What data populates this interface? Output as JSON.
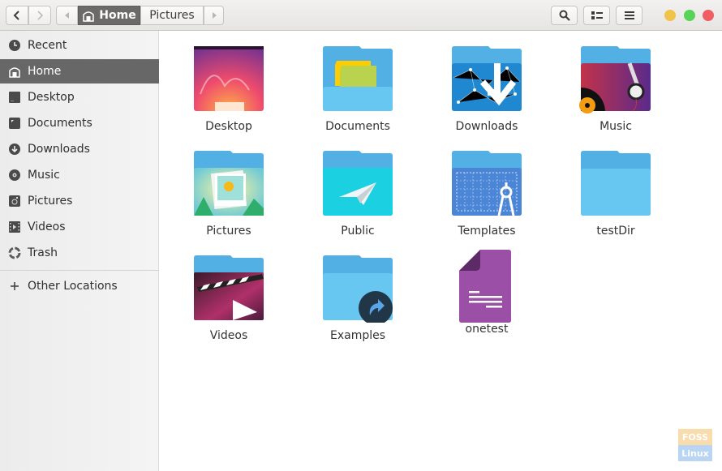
{
  "header": {
    "back_label": "‹",
    "forward_label": "›",
    "path": [
      {
        "label": "Home",
        "icon": "home-icon",
        "active": true
      },
      {
        "label": "Pictures",
        "active": false
      }
    ],
    "search_icon": "search-icon",
    "view_icon": "list-view-icon",
    "menu_icon": "hamburger-menu-icon",
    "window_controls": {
      "minimize_color": "#f0c34b",
      "maximize_color": "#58d357",
      "close_color": "#ee5e63"
    }
  },
  "sidebar": {
    "items": [
      {
        "label": "Recent",
        "icon": "clock-icon"
      },
      {
        "label": "Home",
        "icon": "home-icon",
        "active": true
      },
      {
        "label": "Desktop",
        "icon": "desktop-icon"
      },
      {
        "label": "Documents",
        "icon": "document-icon"
      },
      {
        "label": "Downloads",
        "icon": "download-icon"
      },
      {
        "label": "Music",
        "icon": "music-icon"
      },
      {
        "label": "Pictures",
        "icon": "camera-icon"
      },
      {
        "label": "Videos",
        "icon": "film-icon"
      },
      {
        "label": "Trash",
        "icon": "trash-icon"
      }
    ],
    "other_locations": {
      "label": "Other Locations",
      "icon": "plus-icon"
    }
  },
  "files": [
    {
      "name": "Desktop",
      "type": "desktop-folder"
    },
    {
      "name": "Documents",
      "type": "documents-folder"
    },
    {
      "name": "Downloads",
      "type": "downloads-folder"
    },
    {
      "name": "Music",
      "type": "music-folder"
    },
    {
      "name": "Pictures",
      "type": "pictures-folder"
    },
    {
      "name": "Public",
      "type": "public-folder"
    },
    {
      "name": "Templates",
      "type": "templates-folder"
    },
    {
      "name": "testDir",
      "type": "folder"
    },
    {
      "name": "Videos",
      "type": "videos-folder"
    },
    {
      "name": "Examples",
      "type": "link-folder"
    },
    {
      "name": "onetest",
      "type": "document-file"
    }
  ],
  "watermark": {
    "top": "FOSS",
    "bottom": "Linux"
  },
  "colors": {
    "folder_back": "#52b0e4",
    "folder_front": "#68c7f1",
    "sidebar_active": "#676767"
  }
}
